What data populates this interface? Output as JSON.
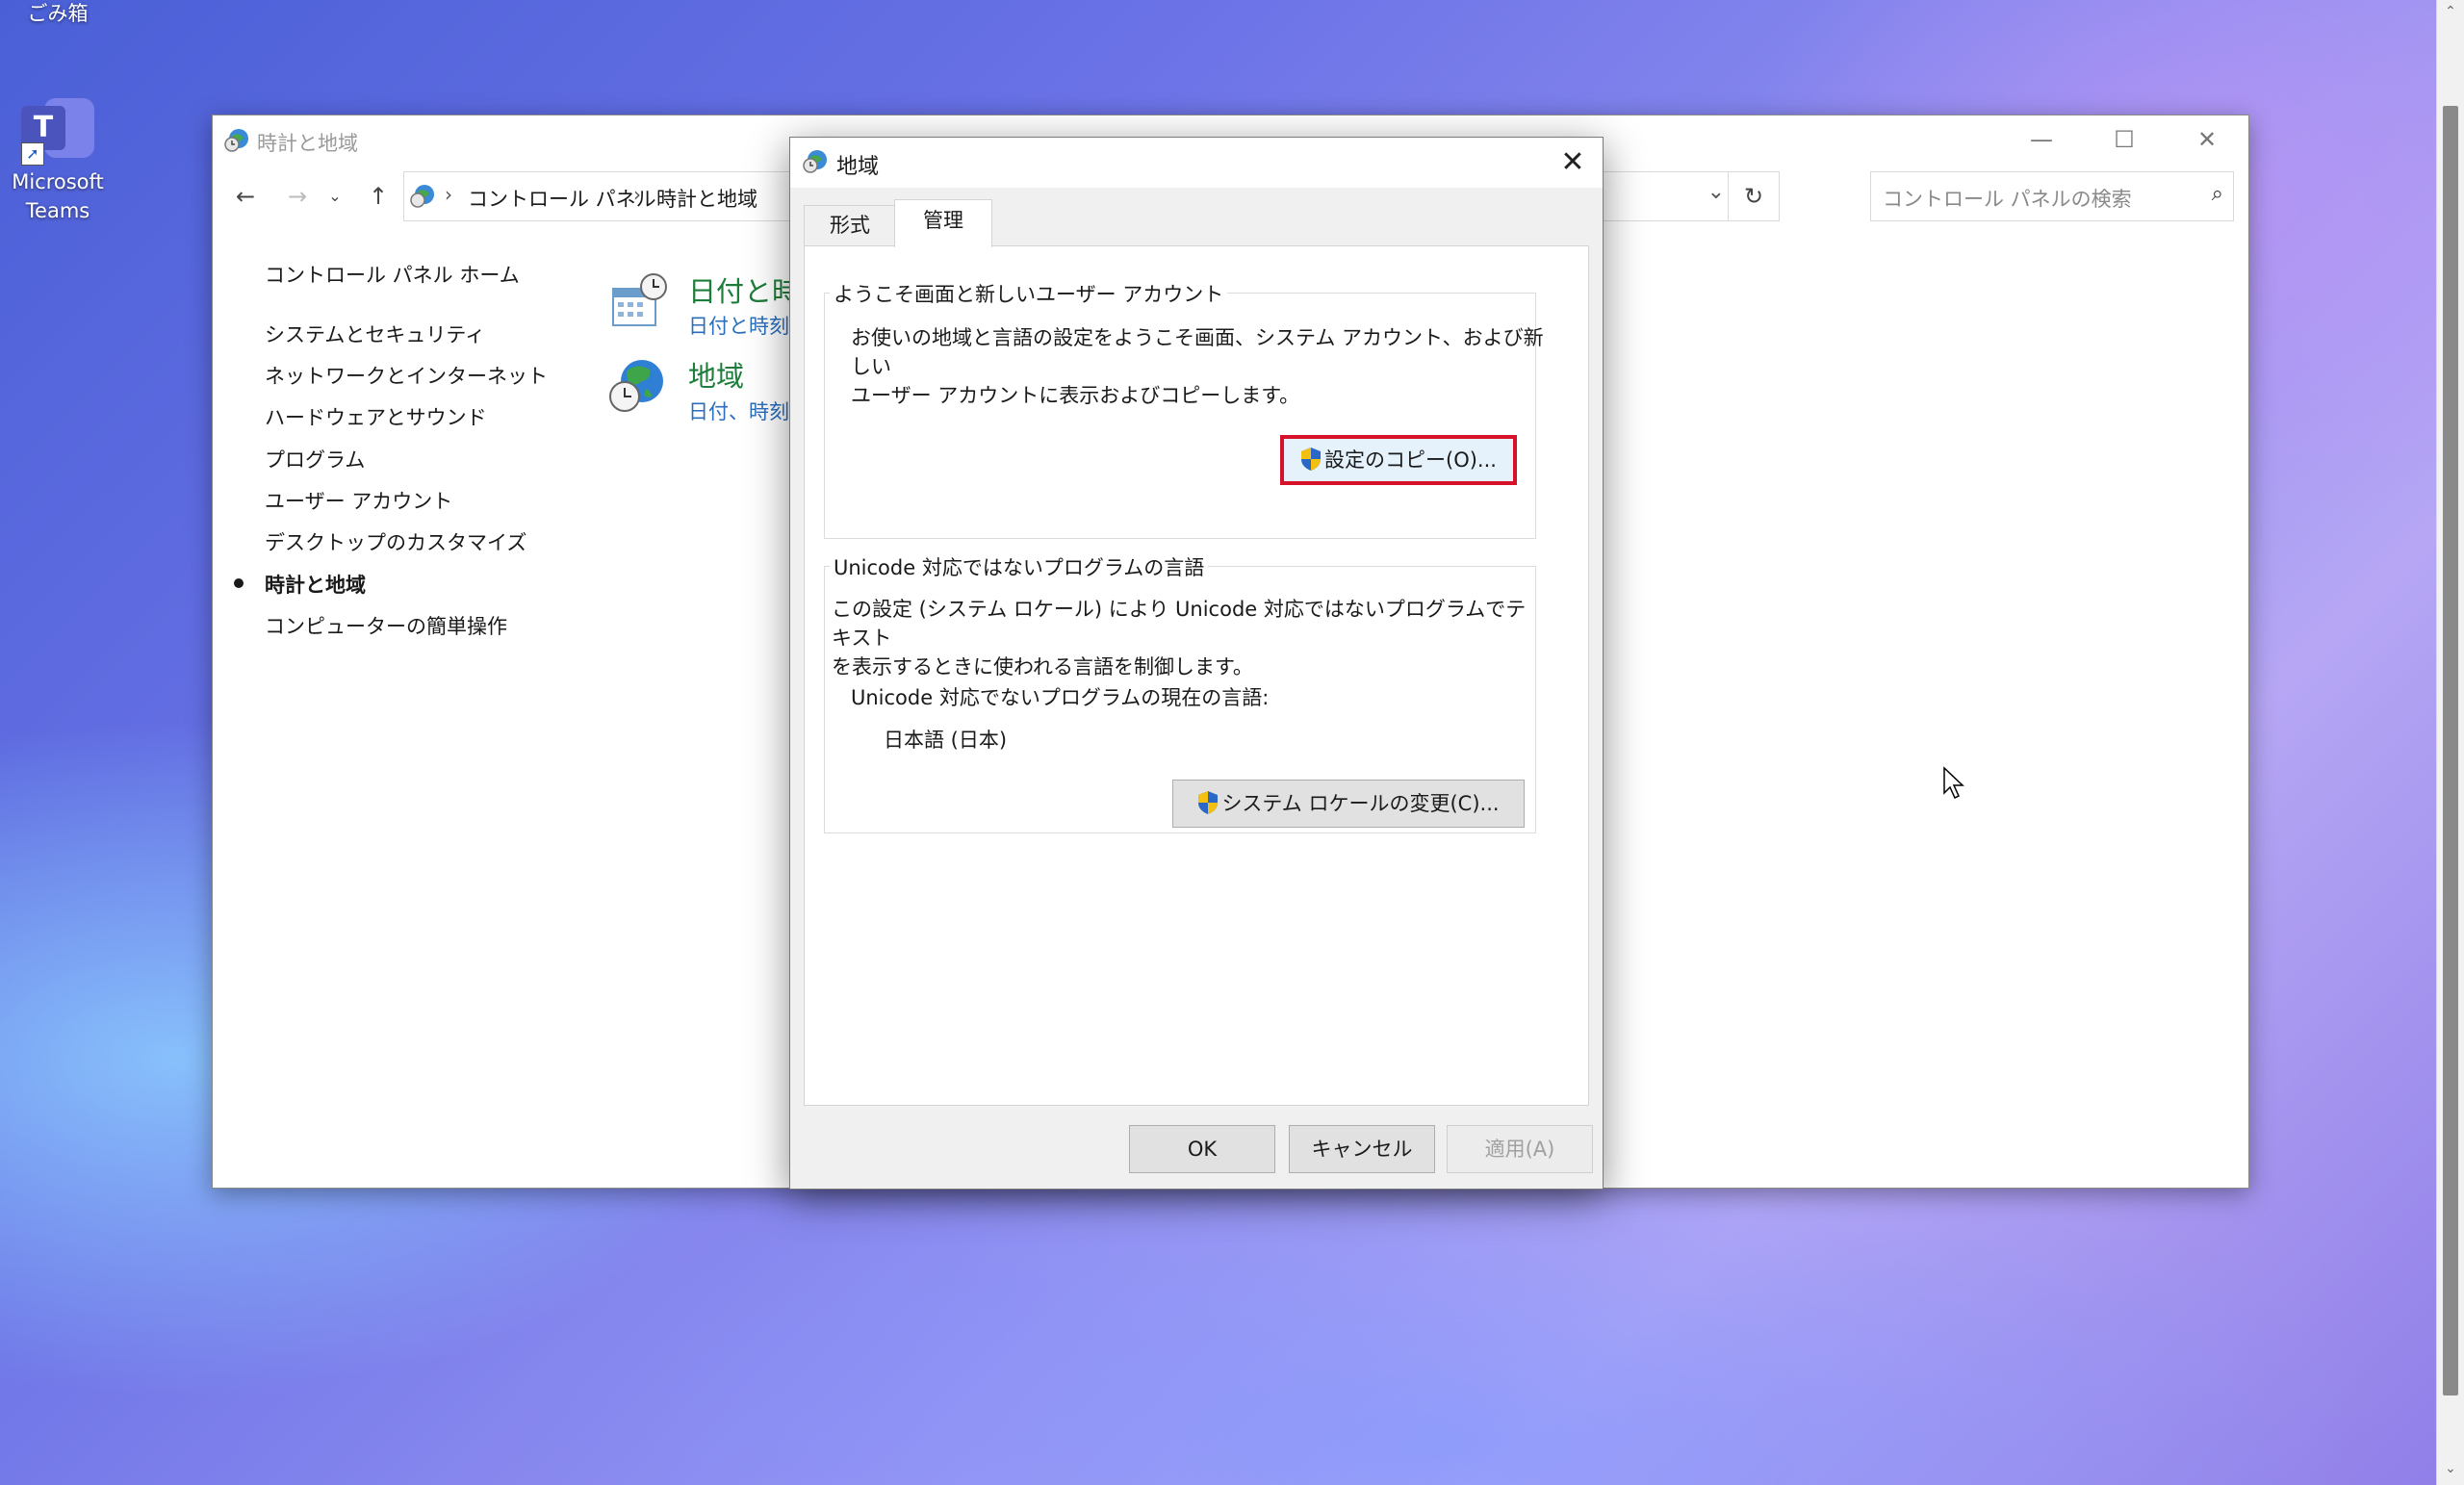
{
  "desktop": {
    "recycle_bin_label": "ごみ箱",
    "teams_label_line1": "Microsoft",
    "teams_label_line2": "Teams"
  },
  "control_panel": {
    "title": "時計と地域",
    "breadcrumb": [
      "コントロール パネル",
      "時計と地域"
    ],
    "search_placeholder": "コントロール パネルの検索",
    "sidebar": {
      "home": "コントロール パネル ホーム",
      "items": [
        "システムとセキュリティ",
        "ネットワークとインターネット",
        "ハードウェアとサウンド",
        "プログラム",
        "ユーザー アカウント",
        "デスクトップのカスタマイズ",
        "時計と地域",
        "コンピューターの簡単操作"
      ],
      "active_item": "時計と地域"
    },
    "categories": [
      {
        "title": "日付と時",
        "sub": "日付と時刻",
        "icon": "calendar-clock-icon"
      },
      {
        "title": "地域",
        "sub": "日付、時刻",
        "icon": "globe-clock-icon"
      }
    ]
  },
  "dialog": {
    "title": "地域",
    "tabs": [
      "形式",
      "管理"
    ],
    "active_tab": "管理",
    "welcome_group": {
      "label": "ようこそ画面と新しいユーザー アカウント",
      "description_line1": "お使いの地域と言語の設定をようこそ画面、システム アカウント、および新しい",
      "description_line2": "ユーザー アカウントに表示およびコピーします。",
      "button": "設定のコピー(O)..."
    },
    "unicode_group": {
      "label": "Unicode 対応ではないプログラムの言語",
      "description_line1": "この設定 (システム ロケール) により Unicode 対応ではないプログラムでテキスト",
      "description_line2": "を表示するときに使われる言語を制御します。",
      "current_label": "Unicode 対応でないプログラムの現在の言語:",
      "current_value": "日本語 (日本)",
      "button": "システム ロケールの変更(C)..."
    },
    "buttons": {
      "ok": "OK",
      "cancel": "キャンセル",
      "apply": "適用(A)"
    }
  }
}
